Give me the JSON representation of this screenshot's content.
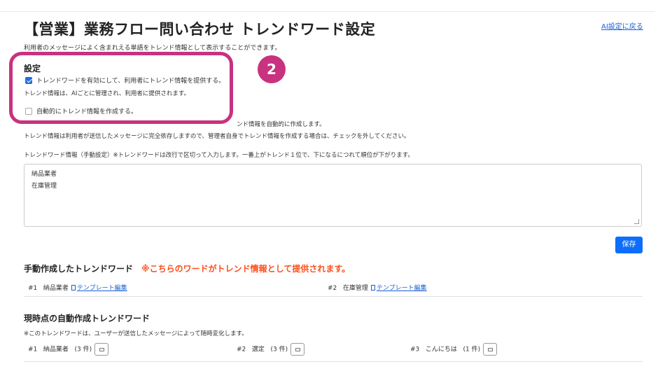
{
  "page": {
    "title": "【営業】業務フロー問い合わせ トレンドワード設定",
    "back_link": "AI設定に戻る",
    "subtitle": "利用者のメッセージによく含まれえる単語をトレンド情報として表示することができます。"
  },
  "settings": {
    "heading": "設定",
    "enable_label": "トレンドワードを有効にして、利用者にトレンド情報を提供する。",
    "enable_checked": true,
    "enable_note": "トレンド情報は、AIごとに管理され、利用者に提供されます。",
    "auto_label": "自動的にトレンド情報を作成する。",
    "auto_checked": false,
    "auto_note_partial": "ンド情報を自動的に作成します。",
    "auto_note2": "トレンド情報は利用者が送信したメッセージに完全依存しますので、管理者自身でトレンド情報を作成する場合は、チェックを外してください。"
  },
  "annotation": {
    "badge": "2",
    "color": "#c8327f"
  },
  "manual_input": {
    "label": "トレンドワード情報（手動設定）※トレンドワードは改行で区切って入力します。一番上がトレンド１位で、下になるにつれて順位が下がります。",
    "lines": [
      "納品業者",
      "在庫管理"
    ]
  },
  "save_label": "保存",
  "manual_section": {
    "heading": "手動作成したトレンドワード",
    "warning": "※こちらのワードがトレンド情報として提供されます。",
    "items": [
      {
        "rank": "#1",
        "word": "納品業者",
        "link": "テンプレート編集"
      },
      {
        "rank": "#2",
        "word": "在庫管理",
        "link": "テンプレート編集"
      }
    ]
  },
  "auto_section": {
    "heading": "現時点の自動作成トレンドワード",
    "note": "※このトレンドワードは、ユーザーが送信したメッセージによって随時変化します。",
    "items": [
      {
        "rank": "#1",
        "word": "納品業者",
        "count": "(3 件)"
      },
      {
        "rank": "#2",
        "word": "選定",
        "count": "(3 件)"
      },
      {
        "rank": "#3",
        "word": "こんにちは",
        "count": "(1 件)"
      }
    ]
  }
}
